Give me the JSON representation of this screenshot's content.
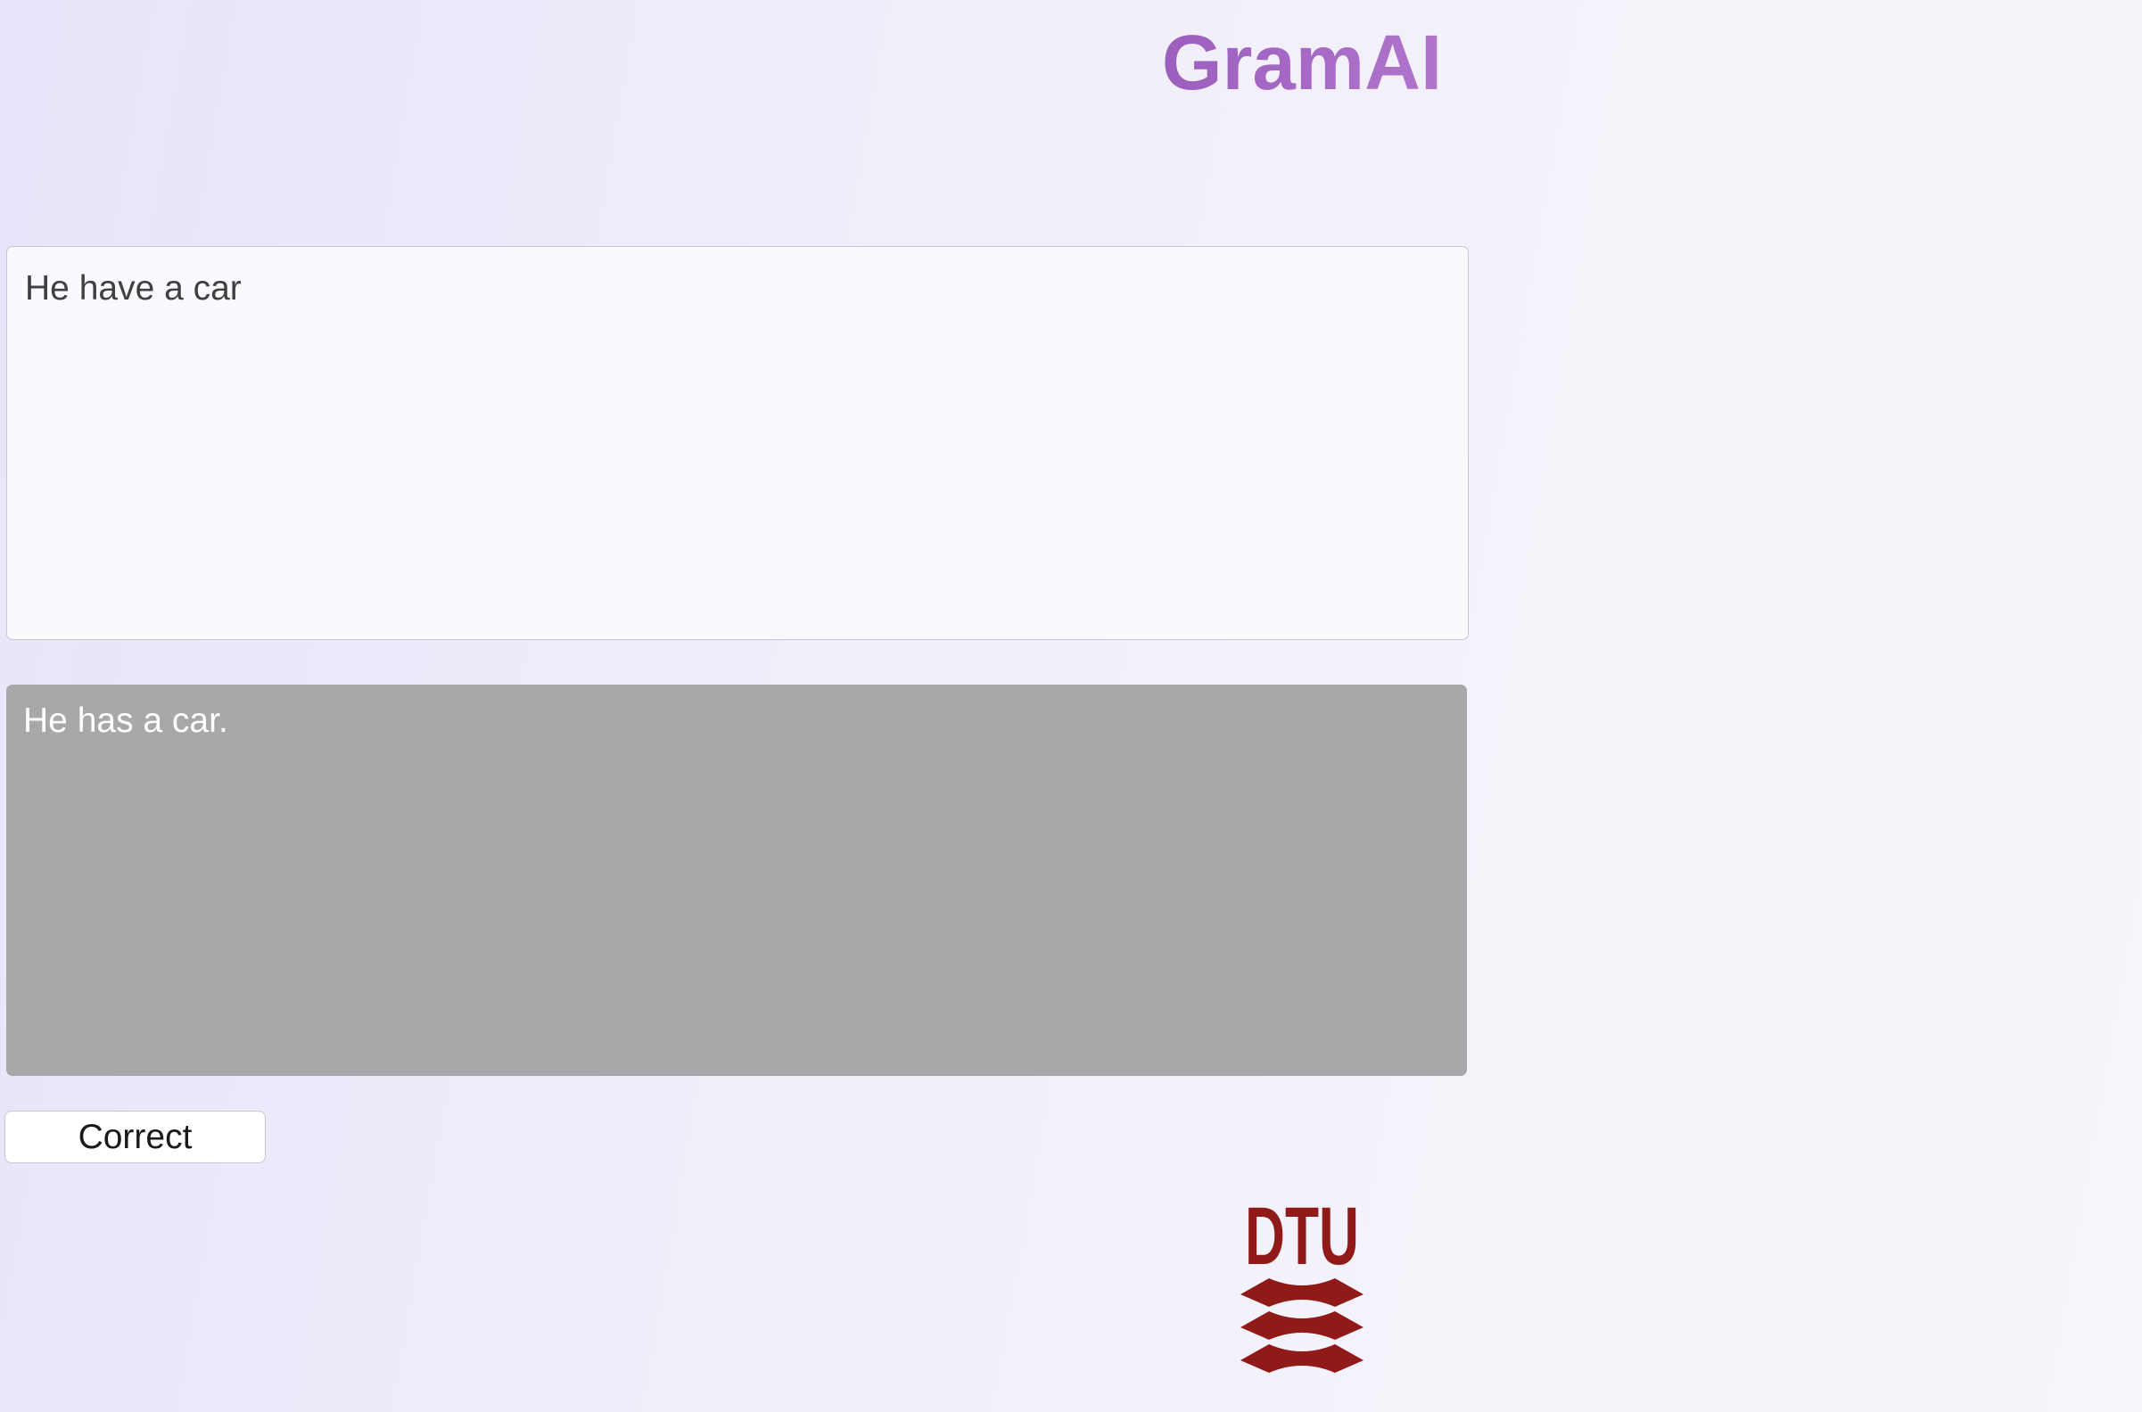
{
  "header": {
    "title": "GramAI"
  },
  "editor": {
    "input_value": "He have a car",
    "output_text": "He has a car."
  },
  "actions": {
    "correct_label": "Correct"
  },
  "footer": {
    "logo_text": "DTU",
    "logo_color": "#8f1a17"
  },
  "theme": {
    "title_gradient_start": "#9254b8",
    "title_gradient_end": "#b97fd2",
    "output_background": "#a8a8ab"
  }
}
